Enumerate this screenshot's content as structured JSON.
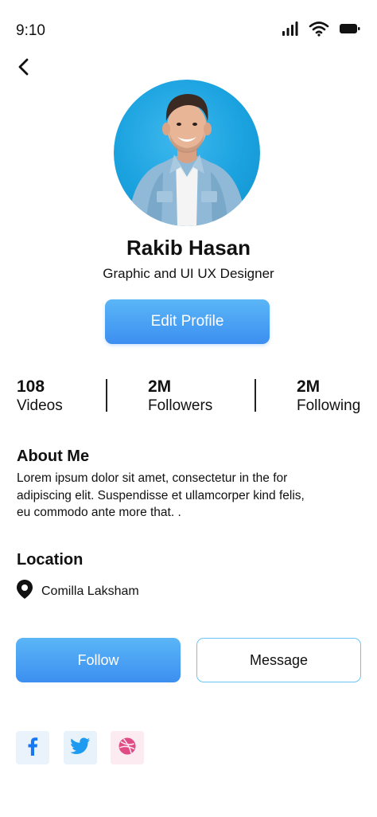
{
  "status_bar": {
    "time": "9:10",
    "icons": [
      "cellular-signal-icon",
      "wifi-icon",
      "battery-icon"
    ]
  },
  "nav": {
    "back_icon": "chevron-left-icon"
  },
  "profile": {
    "name": "Rakib Hasan",
    "role": "Graphic and UI UX Designer",
    "edit_button": "Edit Profile"
  },
  "stats": [
    {
      "value": "108",
      "label": "Videos"
    },
    {
      "value": "2M",
      "label": "Followers"
    },
    {
      "value": "2M",
      "label": "Following"
    }
  ],
  "about": {
    "title": "About Me",
    "text": "Lorem ipsum dolor sit amet, consectetur in the for adipiscing elit. Suspendisse et ullamcorper kind felis, eu commodo ante more that. ."
  },
  "location": {
    "title": "Location",
    "icon": "map-pin-icon",
    "place": "Comilla Laksham"
  },
  "actions": {
    "follow": "Follow",
    "message": "Message"
  },
  "social": [
    {
      "name": "facebook",
      "icon": "facebook-icon",
      "color": "#1877f2"
    },
    {
      "name": "twitter",
      "icon": "twitter-icon",
      "color": "#1d9bf0"
    },
    {
      "name": "dribbble",
      "icon": "dribbble-icon",
      "color": "#e04b86"
    }
  ],
  "colors": {
    "primary_gradient_top": "#5bb6f7",
    "primary_gradient_bottom": "#3c8ff0",
    "message_border": "#6cc4f5",
    "avatar_background": "#1aa2df"
  }
}
